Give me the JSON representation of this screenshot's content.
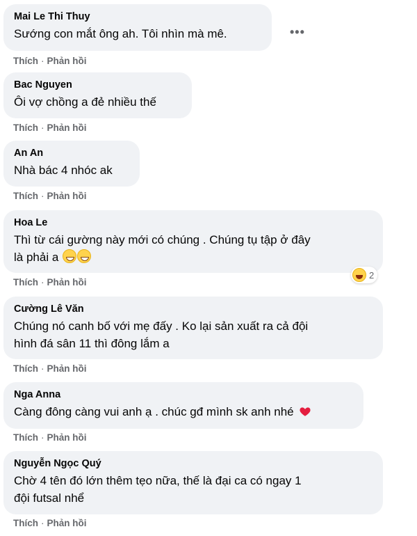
{
  "actions": {
    "like": "Thích",
    "separator": "·",
    "reply": "Phản hồi"
  },
  "more_menu": "•••",
  "comments": [
    {
      "author": "Mai Le Thi Thuy",
      "lines": [
        "Sướng con mắt ông ah. Tôi nhìn mà mê."
      ]
    },
    {
      "author": "Bac Nguyen",
      "lines": [
        "Ôi vợ chồng a đẻ nhiều thế"
      ]
    },
    {
      "author": "An An",
      "lines": [
        "Nhà bác 4 nhóc ak"
      ]
    },
    {
      "author": "Hoa Le",
      "lines": [
        "Thì từ cái gường này mới có chúng . Chúng tụ tập ở đây",
        "là phải a"
      ],
      "emojis": [
        "grinning-squinting-face",
        "grinning-squinting-face"
      ],
      "reaction": {
        "icon": "laughing-face",
        "count": "2"
      }
    },
    {
      "author": "Cường Lê Văn",
      "lines": [
        "Chúng nó canh bố với mẹ đấy . Ko lại sản xuất ra cả đội",
        "hình đá sân 11 thì đông lắm a"
      ]
    },
    {
      "author": "Nga Anna",
      "lines": [
        "Càng đông càng vui anh ạ . chúc gđ mình sk anh nhé"
      ],
      "emojis": [
        "red-heart"
      ]
    },
    {
      "author": "Nguyễn Ngọc Quý",
      "lines": [
        "Chờ 4 tên đó lớn thêm tẹo nữa, thế là đại ca có ngay 1",
        "đội futsal nhể"
      ]
    }
  ],
  "colors": {
    "bubble": "#f0f2f5",
    "secondary_text": "#65676b",
    "heart": "#e41e3f",
    "emoji": "#ffd34d"
  }
}
